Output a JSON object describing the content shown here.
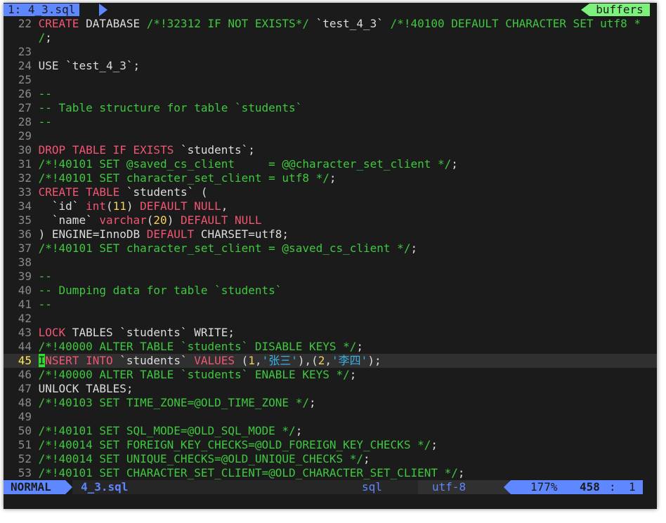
{
  "tabline": {
    "active_tab": "1: 4_3.sql",
    "buffers_label": "buffers"
  },
  "lines": [
    {
      "n": "22",
      "tokens": [
        [
          "kw",
          "CREATE"
        ],
        [
          "p",
          " DATABASE "
        ],
        [
          "cm",
          "/*!32312 IF NOT EXISTS*/"
        ],
        [
          "p",
          " `test_4_3` "
        ],
        [
          "cm",
          "/*!40100 DEFAULT CHARACTER SET utf8 *"
        ]
      ]
    },
    {
      "n": "",
      "tokens": [
        [
          "cm",
          "/"
        ],
        [
          "p",
          ";"
        ]
      ]
    },
    {
      "n": "23",
      "tokens": []
    },
    {
      "n": "24",
      "tokens": [
        [
          "p",
          "USE `test_4_3`;"
        ]
      ]
    },
    {
      "n": "25",
      "tokens": []
    },
    {
      "n": "26",
      "tokens": [
        [
          "cm",
          "--"
        ]
      ]
    },
    {
      "n": "27",
      "tokens": [
        [
          "cm",
          "-- Table structure for table `students`"
        ]
      ]
    },
    {
      "n": "28",
      "tokens": [
        [
          "cm",
          "--"
        ]
      ]
    },
    {
      "n": "29",
      "tokens": []
    },
    {
      "n": "30",
      "tokens": [
        [
          "kw",
          "DROP"
        ],
        [
          "p",
          " "
        ],
        [
          "kw",
          "TABLE"
        ],
        [
          "p",
          " "
        ],
        [
          "kw",
          "IF"
        ],
        [
          "p",
          " "
        ],
        [
          "kw",
          "EXISTS"
        ],
        [
          "p",
          " `students`;"
        ]
      ]
    },
    {
      "n": "31",
      "tokens": [
        [
          "cm",
          "/*!40101 SET @saved_cs_client     = @@character_set_client */"
        ],
        [
          "p",
          ";"
        ]
      ]
    },
    {
      "n": "32",
      "tokens": [
        [
          "cm",
          "/*!40101 SET character_set_client = utf8 */"
        ],
        [
          "p",
          ";"
        ]
      ]
    },
    {
      "n": "33",
      "tokens": [
        [
          "kw",
          "CREATE"
        ],
        [
          "p",
          " "
        ],
        [
          "kw",
          "TABLE"
        ],
        [
          "p",
          " `students` ("
        ]
      ]
    },
    {
      "n": "34",
      "tokens": [
        [
          "p",
          "  `id` "
        ],
        [
          "kw",
          "int"
        ],
        [
          "p",
          "("
        ],
        [
          "num",
          "11"
        ],
        [
          "p",
          ") "
        ],
        [
          "kw",
          "DEFAULT"
        ],
        [
          "p",
          " "
        ],
        [
          "kw",
          "NULL"
        ],
        [
          "p",
          ","
        ]
      ]
    },
    {
      "n": "35",
      "tokens": [
        [
          "p",
          "  `name` "
        ],
        [
          "kw",
          "varchar"
        ],
        [
          "p",
          "("
        ],
        [
          "num",
          "20"
        ],
        [
          "p",
          ") "
        ],
        [
          "kw",
          "DEFAULT"
        ],
        [
          "p",
          " "
        ],
        [
          "kw",
          "NULL"
        ]
      ]
    },
    {
      "n": "36",
      "tokens": [
        [
          "p",
          ") ENGINE=InnoDB "
        ],
        [
          "kw",
          "DEFAULT"
        ],
        [
          "p",
          " CHARSET=utf8;"
        ]
      ]
    },
    {
      "n": "37",
      "tokens": [
        [
          "cm",
          "/*!40101 SET character_set_client = @saved_cs_client */"
        ],
        [
          "p",
          ";"
        ]
      ]
    },
    {
      "n": "38",
      "tokens": []
    },
    {
      "n": "39",
      "tokens": [
        [
          "cm",
          "--"
        ]
      ]
    },
    {
      "n": "40",
      "tokens": [
        [
          "cm",
          "-- Dumping data for table `students`"
        ]
      ]
    },
    {
      "n": "41",
      "tokens": [
        [
          "cm",
          "--"
        ]
      ]
    },
    {
      "n": "42",
      "tokens": []
    },
    {
      "n": "43",
      "tokens": [
        [
          "kw",
          "LOCK"
        ],
        [
          "p",
          " TABLES `students` WRITE;"
        ]
      ]
    },
    {
      "n": "44",
      "tokens": [
        [
          "cm",
          "/*!40000 ALTER TABLE `students` DISABLE KEYS */"
        ],
        [
          "p",
          ";"
        ]
      ]
    },
    {
      "n": "45",
      "current": true,
      "tokens": [
        [
          "cur",
          "I"
        ],
        [
          "kw",
          "NSERT"
        ],
        [
          "p",
          " "
        ],
        [
          "kw",
          "INTO"
        ],
        [
          "p",
          " `students` "
        ],
        [
          "kw",
          "VALUES"
        ],
        [
          "p",
          " ("
        ],
        [
          "num",
          "1"
        ],
        [
          "p",
          ","
        ],
        [
          "str",
          "'张三'"
        ],
        [
          "p",
          "),("
        ],
        [
          "num",
          "2"
        ],
        [
          "p",
          ","
        ],
        [
          "str",
          "'李四'"
        ],
        [
          "p",
          ");"
        ]
      ]
    },
    {
      "n": "46",
      "tokens": [
        [
          "cm",
          "/*!40000 ALTER TABLE `students` ENABLE KEYS */"
        ],
        [
          "p",
          ";"
        ]
      ]
    },
    {
      "n": "47",
      "tokens": [
        [
          "p",
          "UNLOCK TABLES;"
        ]
      ]
    },
    {
      "n": "48",
      "tokens": [
        [
          "cm",
          "/*!40103 SET TIME_ZONE=@OLD_TIME_ZONE */"
        ],
        [
          "p",
          ";"
        ]
      ]
    },
    {
      "n": "49",
      "tokens": []
    },
    {
      "n": "50",
      "tokens": [
        [
          "cm",
          "/*!40101 SET SQL_MODE=@OLD_SQL_MODE */"
        ],
        [
          "p",
          ";"
        ]
      ]
    },
    {
      "n": "51",
      "tokens": [
        [
          "cm",
          "/*!40014 SET FOREIGN_KEY_CHECKS=@OLD_FOREIGN_KEY_CHECKS */"
        ],
        [
          "p",
          ";"
        ]
      ]
    },
    {
      "n": "52",
      "tokens": [
        [
          "cm",
          "/*!40014 SET UNIQUE_CHECKS=@OLD_UNIQUE_CHECKS */"
        ],
        [
          "p",
          ";"
        ]
      ]
    },
    {
      "n": "53",
      "tokens": [
        [
          "cm",
          "/*!40101 SET CHARACTER_SET_CLIENT=@OLD_CHARACTER_SET_CLIENT */"
        ],
        [
          "p",
          ";"
        ]
      ]
    }
  ],
  "statusline": {
    "mode": "NORMAL",
    "filename": "4_3.sql",
    "filetype": "sql",
    "encoding": "utf-8",
    "percent": "177%",
    "line": "458",
    "colon": ":",
    "col": "1"
  },
  "colors": {
    "keyword": "#f25572",
    "comment": "#3fc83f",
    "number": "#f4d05a",
    "string": "#38b0e8",
    "accent": "#5f87ff",
    "buffers": "#7cf27c"
  }
}
